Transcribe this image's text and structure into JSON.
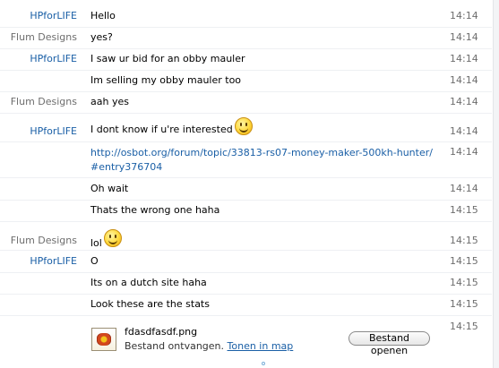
{
  "messages": [
    {
      "sender": "HPforLIFE",
      "text": "Hello",
      "time": "14:14"
    },
    {
      "sender": "Flum Designs",
      "text": "yes?",
      "time": "14:14"
    },
    {
      "sender": "HPforLIFE",
      "text": "I saw ur bid for an obby mauler",
      "time": "14:14"
    },
    {
      "sender": "",
      "text": "Im selling my obby mauler too",
      "time": "14:14"
    },
    {
      "sender": "Flum Designs",
      "text": "aah yes",
      "time": "14:14"
    },
    {
      "sender": "HPforLIFE",
      "text": "I dont know if u're interested",
      "time": "14:14",
      "emoticon": "smile-emoticon"
    },
    {
      "sender": "",
      "link_line1": "http://osbot.org/forum/topic/33813-rs07-money-maker-500kh-hunter/",
      "link_line2": "#entry376704",
      "time": "14:14"
    },
    {
      "sender": "",
      "text": "Oh wait",
      "time": "14:14"
    },
    {
      "sender": "",
      "text": "Thats the wrong one haha",
      "time": "14:15"
    },
    {
      "sender": "Flum Designs",
      "text": "lol",
      "time": "14:15",
      "emoticon": "smile-emoticon"
    },
    {
      "sender": "HPforLIFE",
      "text": "O",
      "time": "14:15"
    },
    {
      "sender": "",
      "text": "Its on a dutch site haha",
      "time": "14:15"
    },
    {
      "sender": "",
      "text": "Look these are the stats",
      "time": "14:15"
    }
  ],
  "file_transfer": {
    "time": "14:15",
    "filename": "fdasdfasdf.png",
    "status": "Bestand ontvangen.",
    "open_in_folder": "Tonen in map",
    "open_button": "Bestand openen",
    "icon": "image-file-icon"
  },
  "colors": {
    "self_sender": "#1a5fa6",
    "other_sender": "#6d6d6d",
    "link": "#1a5fa6"
  }
}
